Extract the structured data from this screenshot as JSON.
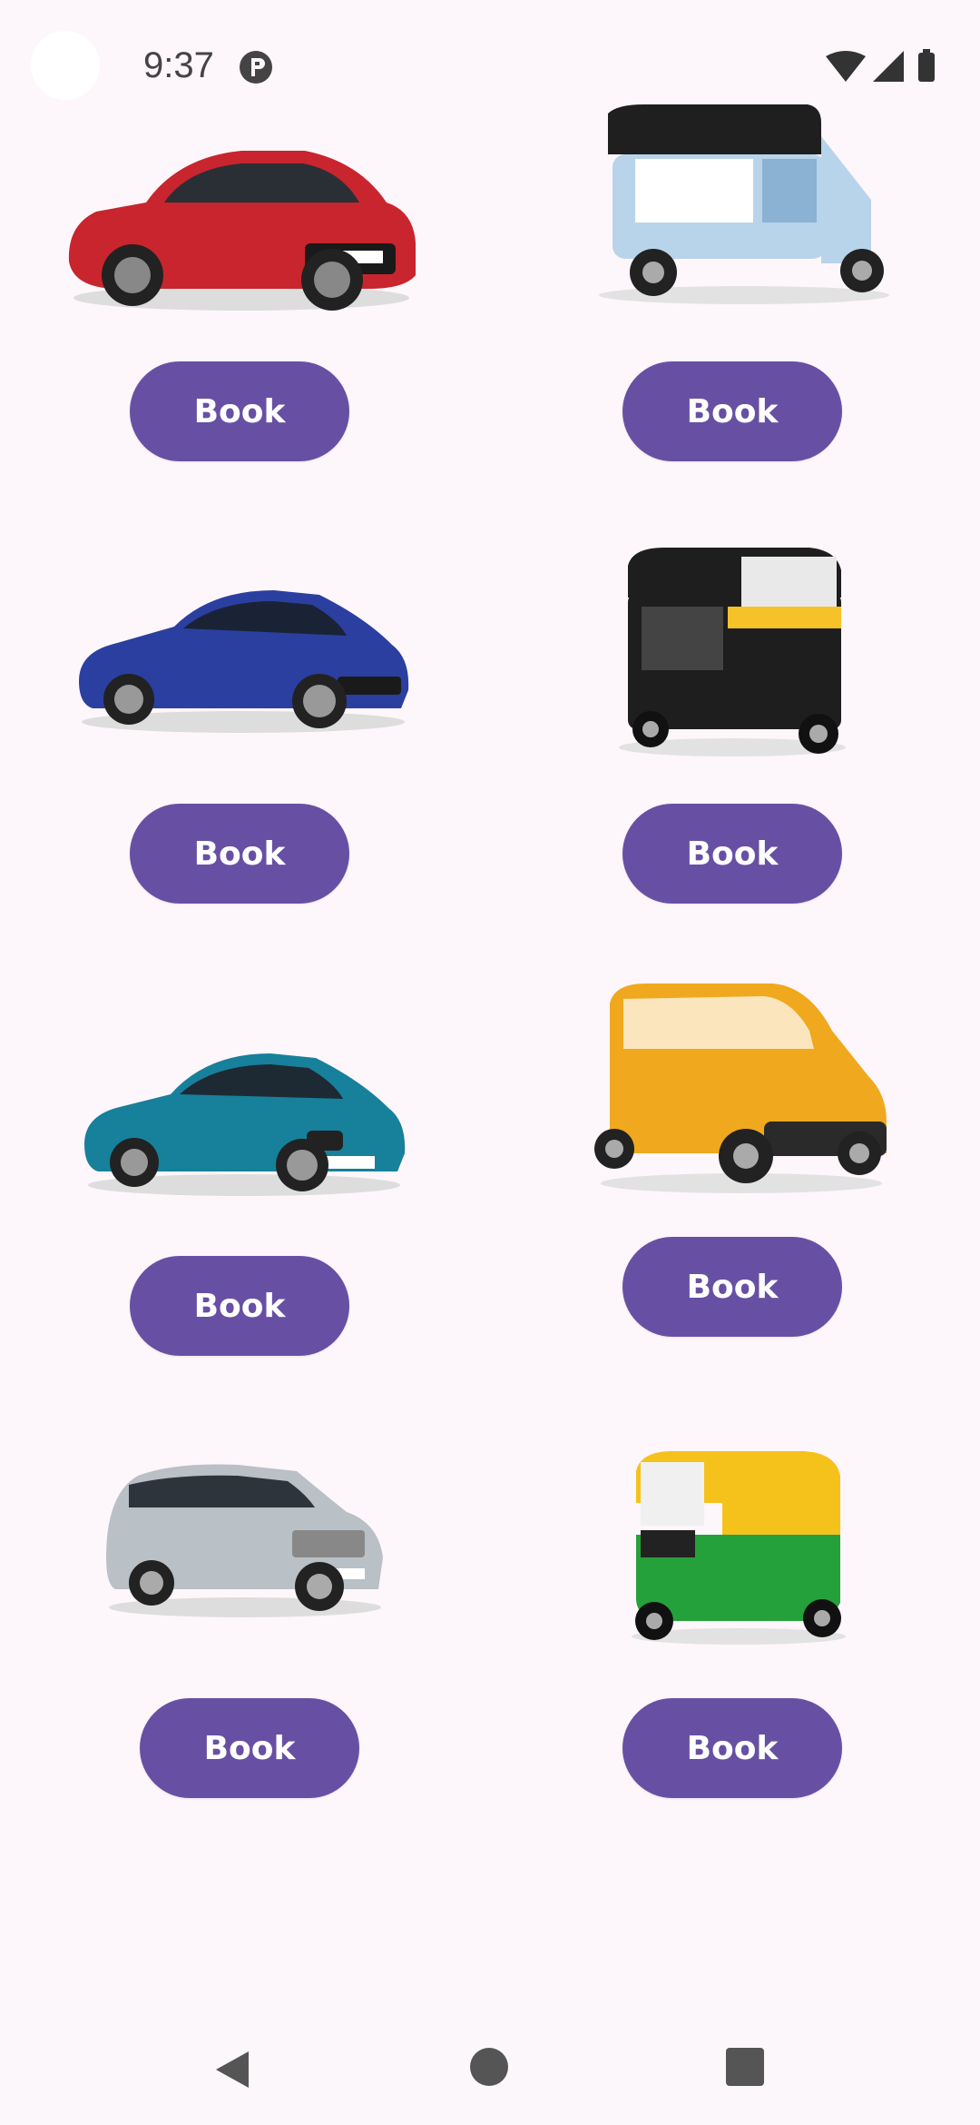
{
  "status_bar": {
    "time": "9:37",
    "icons": [
      "app-notification-icon",
      "wifi-icon",
      "cell-signal-icon",
      "battery-icon"
    ]
  },
  "vehicles": [
    {
      "name": "red-hatchback",
      "body_color": "#c8252e",
      "book_label": "Book"
    },
    {
      "name": "blue-electric-auto-rickshaw",
      "body_color": "#b8d4ea",
      "book_label": "Book"
    },
    {
      "name": "blue-sedan",
      "body_color": "#2b3fa0",
      "book_label": "Book"
    },
    {
      "name": "black-yellow-auto-rickshaw",
      "body_color": "#1e1e1e",
      "book_label": "Book"
    },
    {
      "name": "teal-sedan",
      "body_color": "#17809a",
      "book_label": "Book"
    },
    {
      "name": "yellow-quadricycle",
      "body_color": "#f0a81e",
      "book_label": "Book"
    },
    {
      "name": "silver-mpv",
      "body_color": "#b9c0c6",
      "book_label": "Book"
    },
    {
      "name": "green-yellow-auto-rickshaw",
      "body_color": "#24a13a",
      "book_label": "Book"
    }
  ],
  "colors": {
    "button": "#6750a4",
    "button_text": "#ffffff",
    "background": "#fdf6fb"
  },
  "nav_bar": {
    "icons": [
      "back-icon",
      "home-icon",
      "recents-icon"
    ]
  }
}
